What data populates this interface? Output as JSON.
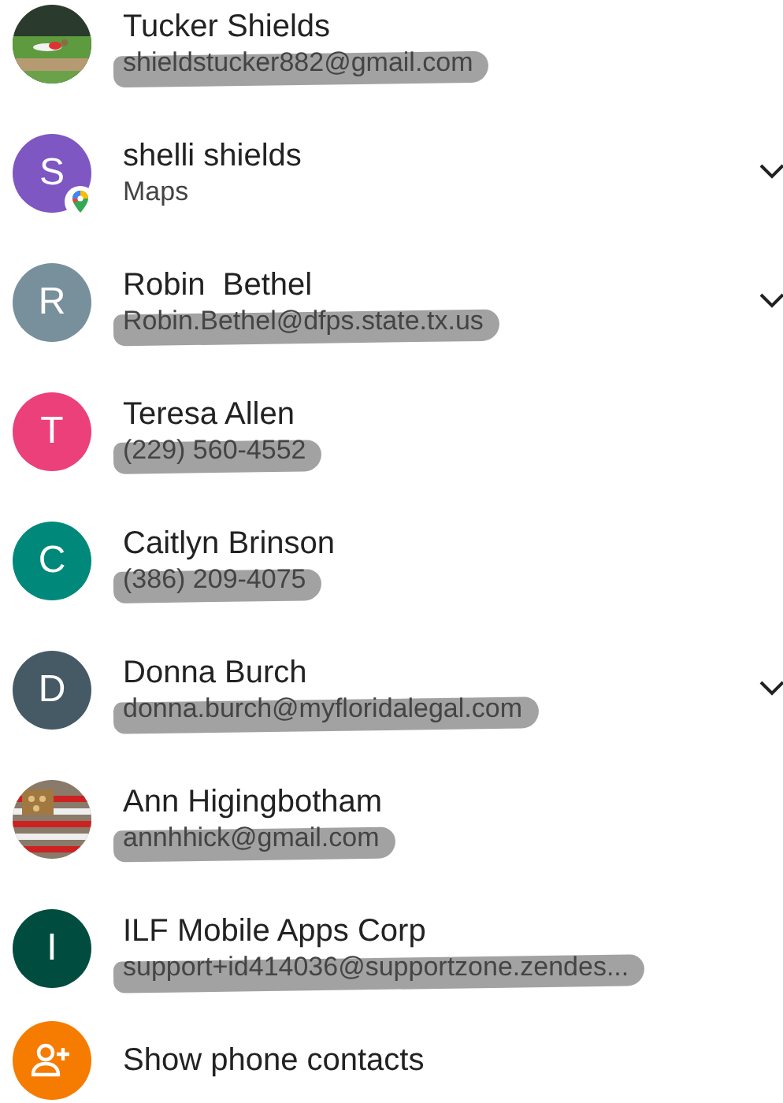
{
  "contacts": [
    {
      "name": "Tucker Shields",
      "detail": "shieldstucker882@gmail.com",
      "app_badge": false,
      "expandable": false,
      "scribbled": true
    },
    {
      "name": "shelli shields",
      "detail": "Maps",
      "avatar": {
        "kind": "letter",
        "letter": "S",
        "color": "#7e57c2"
      },
      "app_badge": true,
      "expandable": true,
      "scribbled": false
    },
    {
      "name": "Robin  Bethel",
      "detail": "Robin.Bethel@dfps.state.tx.us",
      "avatar": {
        "kind": "letter",
        "letter": "R",
        "color": "#78909c"
      },
      "app_badge": false,
      "expandable": true,
      "scribbled": true
    },
    {
      "name": "Teresa Allen",
      "detail": "(229) 560-4552",
      "avatar": {
        "kind": "letter",
        "letter": "T",
        "color": "#ec407a"
      },
      "app_badge": false,
      "expandable": false,
      "scribbled": true
    },
    {
      "name": "Caitlyn Brinson",
      "detail": "(386) 209-4075",
      "avatar": {
        "kind": "letter",
        "letter": "C",
        "color": "#00897b"
      },
      "app_badge": false,
      "expandable": false,
      "scribbled": true
    },
    {
      "name": "Donna Burch",
      "detail": "donna.burch@myfloridalegal.com",
      "avatar": {
        "kind": "letter",
        "letter": "D",
        "color": "#455a64"
      },
      "app_badge": false,
      "expandable": true,
      "scribbled": true
    },
    {
      "name": "Ann Higingbotham",
      "detail": "annhhick@gmail.com",
      "app_badge": false,
      "expandable": false,
      "scribbled": true
    },
    {
      "name": "ILF Mobile Apps Corp",
      "detail": "support+id414036@supportzone.zendes...",
      "avatar": {
        "kind": "letter",
        "letter": "I",
        "color": "#004d40"
      },
      "app_badge": false,
      "expandable": false,
      "scribbled": true
    }
  ],
  "action": {
    "label": "Show phone contacts",
    "color": "#f57c00"
  }
}
